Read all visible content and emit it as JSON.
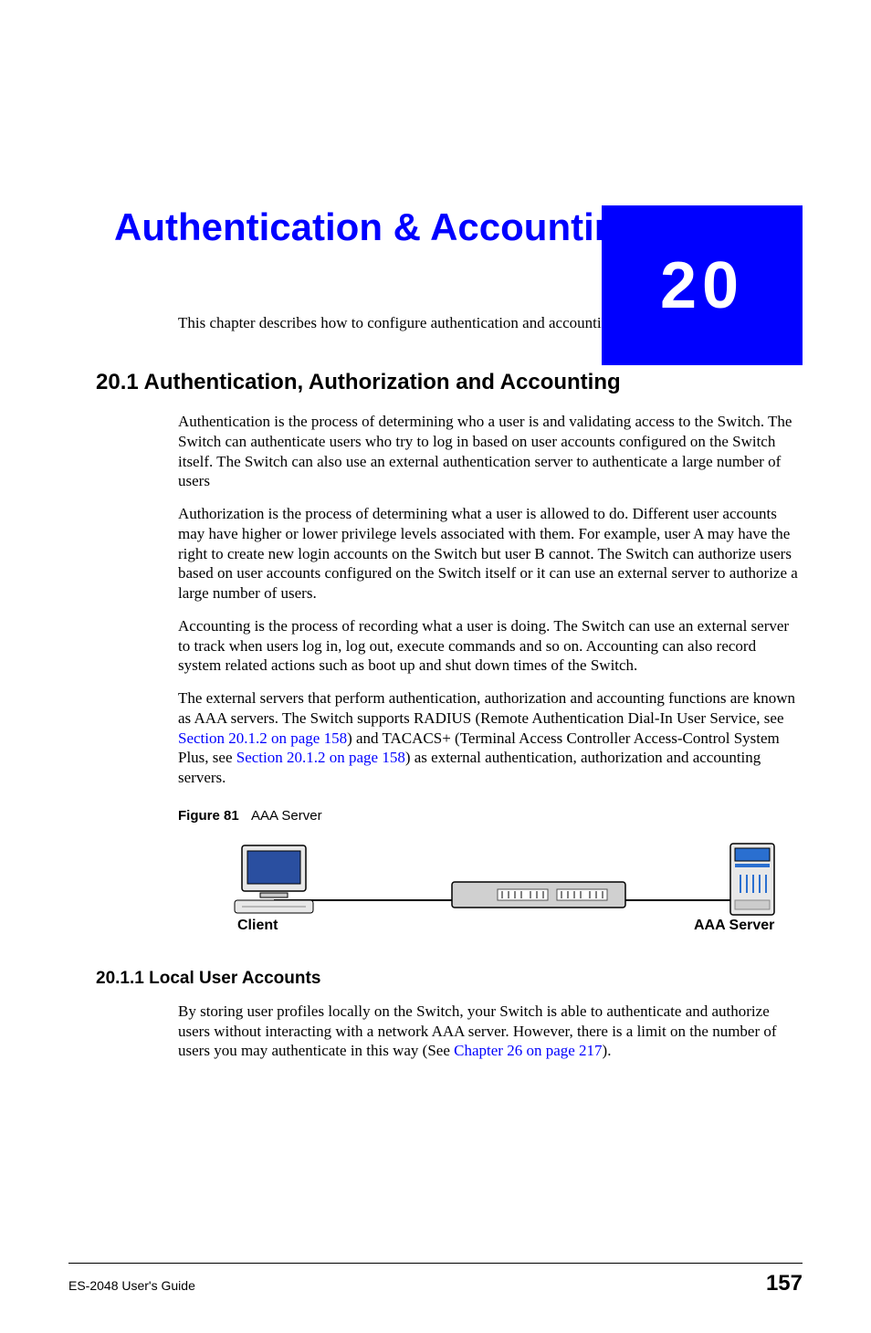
{
  "chapter": {
    "number": "20",
    "title": "Authentication & Accounting"
  },
  "intro": "This chapter describes how to configure authentication and accounting settings on the Switch.",
  "section_20_1": {
    "heading": "20.1  Authentication, Authorization and Accounting",
    "p1": "Authentication is the process of determining who a user is and validating access to the Switch. The Switch can authenticate users who try to log in based on user accounts configured on the Switch itself. The Switch can also use an external authentication server to authenticate a large number of users",
    "p2": "Authorization is the process of determining what a user is allowed to do. Different user accounts may have higher or lower privilege levels associated with them. For example, user A may have the right to create new login accounts on the Switch but user B cannot. The Switch can authorize users based on user accounts configured on the Switch itself or it can use an external server to authorize a large number of users.",
    "p3": "Accounting is the process of recording what a user is doing. The Switch can use an external server to track when users log in, log out, execute commands and so on. Accounting can also record system related actions such as boot up and shut down times of the Switch.",
    "p4_a": "The external servers that perform authentication, authorization and accounting functions are known as AAA servers. The Switch supports RADIUS (Remote Authentication Dial-In User Service, see ",
    "p4_link1": "Section 20.1.2 on page 158",
    "p4_b": ") and TACACS+ (Terminal Access Controller Access-Control System Plus, see ",
    "p4_link2": "Section 20.1.2 on page 158",
    "p4_c": ") as external authentication, authorization and accounting servers."
  },
  "figure81": {
    "label": "Figure 81",
    "caption": "AAA Server",
    "client_label": "Client",
    "server_label": "AAA Server"
  },
  "section_20_1_1": {
    "heading": "20.1.1  Local User Accounts",
    "p1_a": "By storing user profiles locally on the Switch, your Switch is able to authenticate and authorize users without interacting with a network AAA server. However, there is a limit on the number of users you may authenticate in this way (See ",
    "p1_link": "Chapter 26 on page 217",
    "p1_b": ")."
  },
  "footer": {
    "guide": "ES-2048 User's Guide",
    "page": "157"
  }
}
